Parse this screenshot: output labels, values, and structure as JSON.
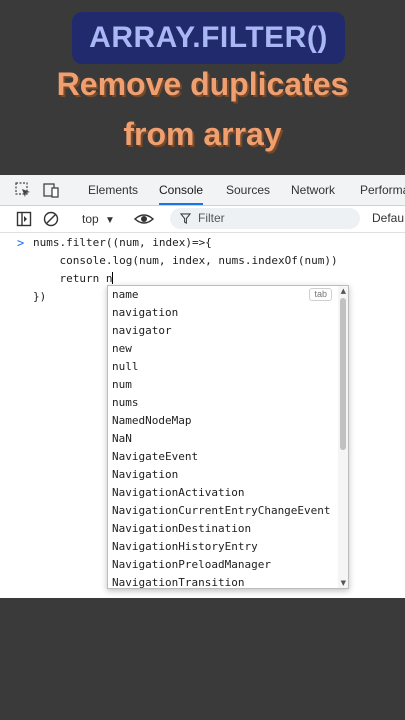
{
  "overlay": {
    "title": "ARRAY.FILTER()",
    "subtitle_line1": "Remove duplicates",
    "subtitle_line2": "from array"
  },
  "devtools": {
    "tabs": [
      {
        "label": "Elements"
      },
      {
        "label": "Console",
        "active": true
      },
      {
        "label": "Sources"
      },
      {
        "label": "Network"
      },
      {
        "label": "Performa"
      }
    ],
    "toolbar": {
      "context": "top",
      "filter_placeholder": "Filter",
      "levels_label": "Defau"
    }
  },
  "console": {
    "prompt": ">",
    "lines": [
      "nums.filter((num, index)=>{",
      "    console.log(num, index, nums.indexOf(num))",
      "    return n",
      "})"
    ]
  },
  "autocomplete": {
    "tab_hint": "tab",
    "items": [
      "name",
      "navigation",
      "navigator",
      "new",
      "null",
      "num",
      "nums",
      "NamedNodeMap",
      "NaN",
      "NavigateEvent",
      "Navigation",
      "NavigationActivation",
      "NavigationCurrentEntryChangeEvent",
      "NavigationDestination",
      "NavigationHistoryEntry",
      "NavigationPreloadManager",
      "NavigationTransition"
    ]
  },
  "colors": {
    "accent": "#1a73e8",
    "title_bg": "#222a6e",
    "title_text": "#a9b8f5",
    "subtitle_text": "#f0a070",
    "background": "#3a3a3a"
  }
}
